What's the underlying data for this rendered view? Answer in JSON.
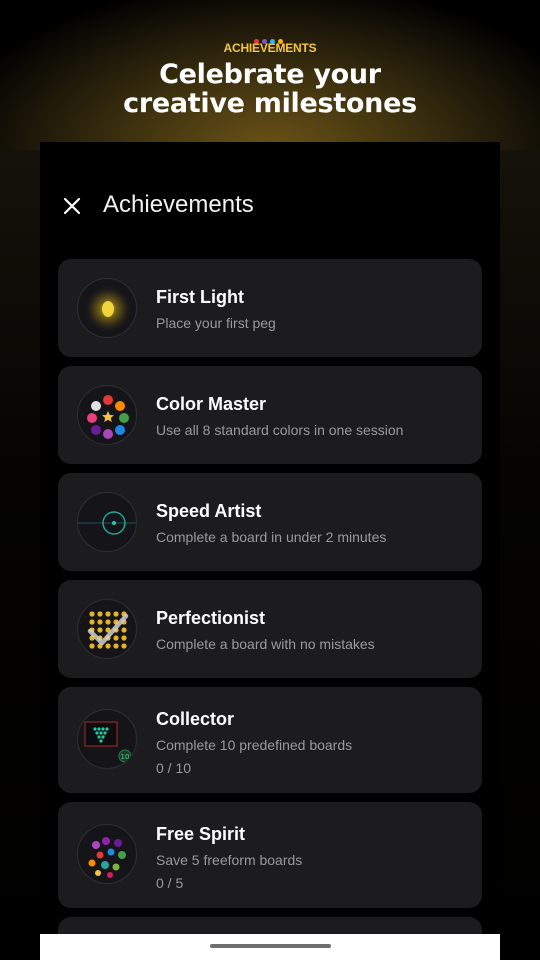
{
  "promo": {
    "label": "ACHIEVEMENTS",
    "headline_line1": "Celebrate your",
    "headline_line2": "creative milestones",
    "dot_colors": [
      "#e53935",
      "#7e57c2",
      "#29b6f6",
      "#ffb300"
    ]
  },
  "sheet": {
    "title": "Achievements",
    "close_icon": "close-icon"
  },
  "achievements": [
    {
      "title": "First Light",
      "description": "Place your first peg",
      "progress": "",
      "icon": "glowing-peg-icon"
    },
    {
      "title": "Color Master",
      "description": "Use all 8 standard colors in one session",
      "progress": "",
      "icon": "color-wheel-icon"
    },
    {
      "title": "Speed Artist",
      "description": "Complete a board in under 2 minutes",
      "progress": "",
      "icon": "stopwatch-icon"
    },
    {
      "title": "Perfectionist",
      "description": "Complete a board with no mistakes",
      "progress": "",
      "icon": "checkmark-grid-icon"
    },
    {
      "title": "Collector",
      "description": "Complete 10 predefined boards",
      "progress": "0 / 10",
      "icon": "board-stack-icon"
    },
    {
      "title": "Free Spirit",
      "description": "Save 5 freeform boards",
      "progress": "0 / 5",
      "icon": "scattered-pegs-icon"
    }
  ],
  "colors": {
    "accent_gold": "#f4c542",
    "card_bg": "#1c1c1e",
    "text_secondary": "#9a9a9e"
  }
}
